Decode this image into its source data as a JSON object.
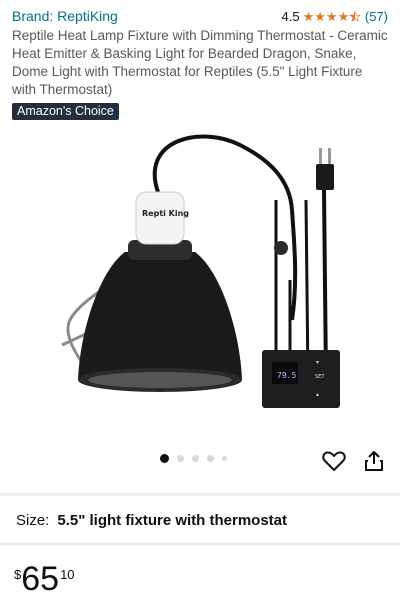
{
  "product": {
    "brand": "Brand: ReptiKing",
    "rating_value": "4.5",
    "rating_stars": 4.5,
    "rating_count": "(57)",
    "title": "Reptile Heat Lamp Fixture with Dimming Thermostat - Ceramic Heat Emitter & Basking Light for Bearded Dragon, Snake, Dome Light with Thermostat for Reptiles (5.5\" Light Fixture with Thermostat)",
    "badge": "Amazon's Choice"
  },
  "image": {
    "bulb_logo": "Repti King",
    "thermostat_display": "79.5",
    "thermostat_button": "SET",
    "colors": {
      "dome": "#1b1b1b",
      "bulb": "#f4f4f4",
      "cord": "#111111"
    }
  },
  "carousel": {
    "count": 5,
    "active": 0
  },
  "actions": {
    "favorite_icon": "heart-icon",
    "share_icon": "share-icon"
  },
  "variant": {
    "size_label": "Size:",
    "size_value": "5.5\" light fixture with thermostat"
  },
  "price": {
    "currency": "$",
    "whole": "65",
    "fraction": "10"
  },
  "colors": {
    "link": "#007185",
    "star": "#de7921",
    "badge_bg": "#232f3e"
  }
}
